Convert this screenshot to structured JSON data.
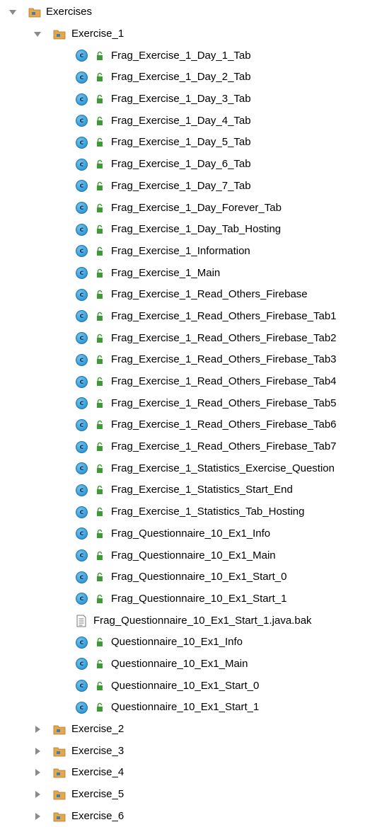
{
  "tree": {
    "root": {
      "label": "Exercises",
      "expanded": true,
      "icon": "package-folder-icon"
    },
    "exercise_1": {
      "label": "Exercise_1",
      "expanded": true,
      "icon": "package-folder-icon",
      "children": [
        {
          "label": "Frag_Exercise_1_Day_1_Tab",
          "icon": "class-icon",
          "access": "public"
        },
        {
          "label": "Frag_Exercise_1_Day_2_Tab",
          "icon": "class-icon",
          "access": "public"
        },
        {
          "label": "Frag_Exercise_1_Day_3_Tab",
          "icon": "class-icon",
          "access": "public"
        },
        {
          "label": "Frag_Exercise_1_Day_4_Tab",
          "icon": "class-icon",
          "access": "public"
        },
        {
          "label": "Frag_Exercise_1_Day_5_Tab",
          "icon": "class-icon",
          "access": "public"
        },
        {
          "label": "Frag_Exercise_1_Day_6_Tab",
          "icon": "class-icon",
          "access": "public"
        },
        {
          "label": "Frag_Exercise_1_Day_7_Tab",
          "icon": "class-icon",
          "access": "public"
        },
        {
          "label": "Frag_Exercise_1_Day_Forever_Tab",
          "icon": "class-icon",
          "access": "public"
        },
        {
          "label": "Frag_Exercise_1_Day_Tab_Hosting",
          "icon": "class-icon",
          "access": "public"
        },
        {
          "label": "Frag_Exercise_1_Information",
          "icon": "class-icon",
          "access": "public"
        },
        {
          "label": "Frag_Exercise_1_Main",
          "icon": "class-icon",
          "access": "public"
        },
        {
          "label": "Frag_Exercise_1_Read_Others_Firebase",
          "icon": "class-icon",
          "access": "public"
        },
        {
          "label": "Frag_Exercise_1_Read_Others_Firebase_Tab1",
          "icon": "class-icon",
          "access": "public"
        },
        {
          "label": "Frag_Exercise_1_Read_Others_Firebase_Tab2",
          "icon": "class-icon",
          "access": "public"
        },
        {
          "label": "Frag_Exercise_1_Read_Others_Firebase_Tab3",
          "icon": "class-icon",
          "access": "public"
        },
        {
          "label": "Frag_Exercise_1_Read_Others_Firebase_Tab4",
          "icon": "class-icon",
          "access": "public"
        },
        {
          "label": "Frag_Exercise_1_Read_Others_Firebase_Tab5",
          "icon": "class-icon",
          "access": "public"
        },
        {
          "label": "Frag_Exercise_1_Read_Others_Firebase_Tab6",
          "icon": "class-icon",
          "access": "public"
        },
        {
          "label": "Frag_Exercise_1_Read_Others_Firebase_Tab7",
          "icon": "class-icon",
          "access": "public"
        },
        {
          "label": "Frag_Exercise_1_Statistics_Exercise_Question",
          "icon": "class-icon",
          "access": "public"
        },
        {
          "label": "Frag_Exercise_1_Statistics_Start_End",
          "icon": "class-icon",
          "access": "public"
        },
        {
          "label": "Frag_Exercise_1_Statistics_Tab_Hosting",
          "icon": "class-icon",
          "access": "public"
        },
        {
          "label": "Frag_Questionnaire_10_Ex1_Info",
          "icon": "class-icon",
          "access": "public"
        },
        {
          "label": "Frag_Questionnaire_10_Ex1_Main",
          "icon": "class-icon",
          "access": "public"
        },
        {
          "label": "Frag_Questionnaire_10_Ex1_Start_0",
          "icon": "class-icon",
          "access": "public"
        },
        {
          "label": "Frag_Questionnaire_10_Ex1_Start_1",
          "icon": "class-icon",
          "access": "public"
        },
        {
          "label": "Frag_Questionnaire_10_Ex1_Start_1.java.bak",
          "icon": "text-file-icon",
          "access": ""
        },
        {
          "label": "Questionnaire_10_Ex1_Info",
          "icon": "class-icon",
          "access": "public"
        },
        {
          "label": "Questionnaire_10_Ex1_Main",
          "icon": "class-icon",
          "access": "public"
        },
        {
          "label": "Questionnaire_10_Ex1_Start_0",
          "icon": "class-icon",
          "access": "public"
        },
        {
          "label": "Questionnaire_10_Ex1_Start_1",
          "icon": "class-icon",
          "access": "public"
        }
      ]
    },
    "collapsed": [
      {
        "label": "Exercise_2",
        "expanded": false,
        "icon": "package-folder-icon"
      },
      {
        "label": "Exercise_3",
        "expanded": false,
        "icon": "package-folder-icon"
      },
      {
        "label": "Exercise_4",
        "expanded": false,
        "icon": "package-folder-icon"
      },
      {
        "label": "Exercise_5",
        "expanded": false,
        "icon": "package-folder-icon"
      },
      {
        "label": "Exercise_6",
        "expanded": false,
        "icon": "package-folder-icon"
      }
    ]
  },
  "colors": {
    "class_icon": "#3aa0dc",
    "lock_icon": "#3d9b35",
    "folder": "#e6a64a",
    "arrow": "#8a8a8a"
  }
}
